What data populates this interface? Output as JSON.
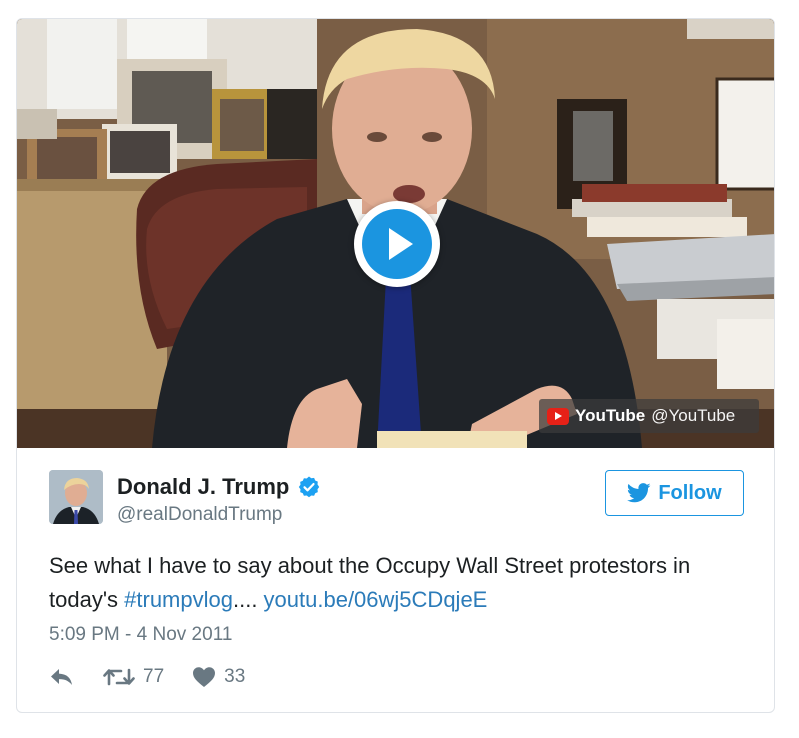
{
  "video": {
    "provider_name": "YouTube",
    "provider_handle": "@YouTube"
  },
  "author": {
    "display_name": "Donald J. Trump",
    "handle": "@realDonaldTrump"
  },
  "follow_label": "Follow",
  "tweet": {
    "text_before": "See what I have to say about the Occupy Wall Street protestors in today's ",
    "hashtag": "#trumpvlog",
    "text_middle": ".... ",
    "link": "youtu.be/06wj5CDqjeE",
    "timestamp": "5:09 PM - 4 Nov 2011"
  },
  "stats": {
    "retweets": "77",
    "likes": "33"
  },
  "colors": {
    "accent": "#1b95e0",
    "link": "#2b7bb9",
    "text": "#1c2022",
    "muted": "#697882",
    "youtube_red": "#e62117"
  },
  "icons": {
    "play": "play-icon",
    "verified": "verified-badge-icon",
    "bird": "twitter-bird-icon",
    "reply": "reply-icon",
    "retweet": "retweet-icon",
    "like": "heart-icon",
    "youtube": "youtube-logo-icon"
  }
}
